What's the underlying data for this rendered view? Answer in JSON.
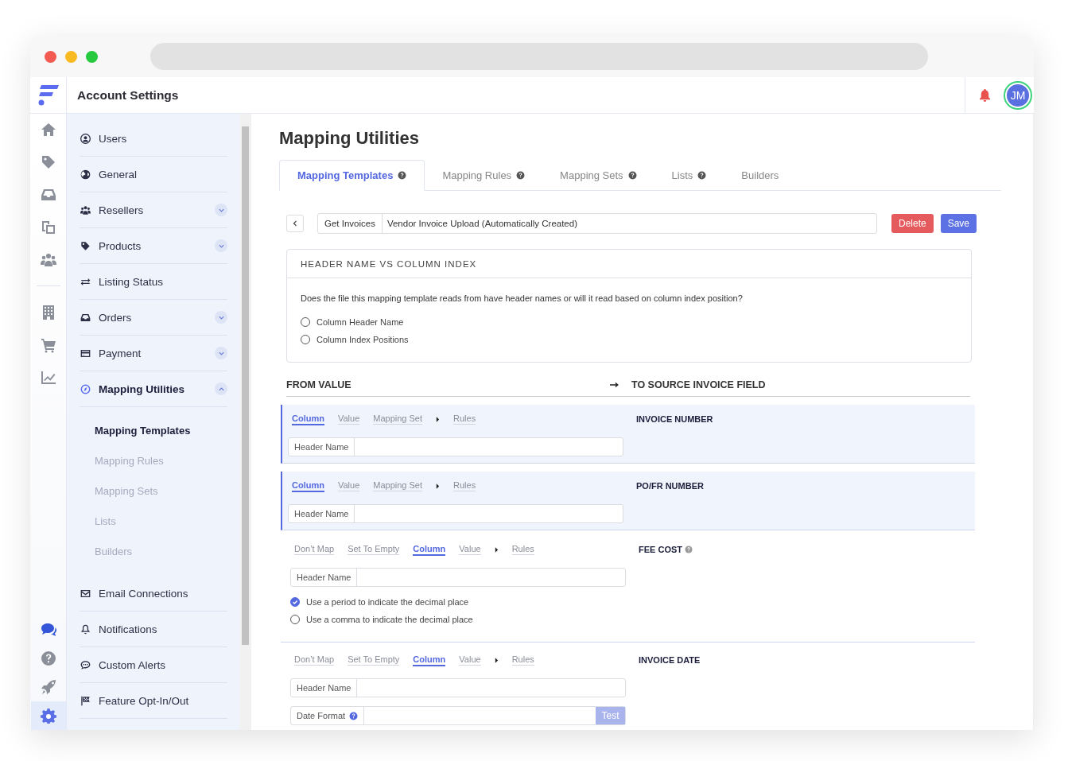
{
  "header": {
    "title": "Account Settings",
    "avatar": "JM"
  },
  "rail": {
    "groups": [
      [
        {
          "selected": false
        },
        {
          "selected": false
        },
        {
          "selected": false
        },
        {
          "selected": false
        },
        {
          "selected": false
        }
      ],
      [
        {
          "selected": false
        },
        {
          "selected": false
        },
        {
          "selected": false
        }
      ],
      [
        {
          "selected": false
        },
        {
          "selected": false
        },
        {
          "selected": false
        },
        {
          "selected": true
        }
      ]
    ]
  },
  "sidebar": {
    "items": [
      {
        "label": "Users",
        "selected": false
      },
      {
        "label": "General",
        "selected": false
      },
      {
        "label": "Resellers",
        "expanded": false,
        "selected": false
      },
      {
        "label": "Products",
        "expanded": false,
        "selected": false
      },
      {
        "label": "Listing Status",
        "selected": false
      },
      {
        "label": "Orders",
        "expanded": false,
        "selected": false
      },
      {
        "label": "Payment",
        "expanded": false,
        "selected": false
      },
      {
        "label": "Mapping Utilities",
        "expanded": true,
        "selected": true,
        "children": [
          {
            "label": "Mapping Templates",
            "selected": true
          },
          {
            "label": "Mapping Rules",
            "selected": false
          },
          {
            "label": "Mapping Sets",
            "selected": false
          },
          {
            "label": "Lists",
            "selected": false
          },
          {
            "label": "Builders",
            "selected": false
          }
        ]
      },
      {
        "label": "Email Connections",
        "selected": false
      },
      {
        "label": "Notifications",
        "selected": false
      },
      {
        "label": "Custom Alerts",
        "selected": false
      },
      {
        "label": "Feature Opt-In/Out",
        "selected": false
      }
    ]
  },
  "page": {
    "title": "Mapping Utilities",
    "tabs": [
      {
        "label": "Mapping Templates",
        "help": true,
        "selected": true
      },
      {
        "label": "Mapping Rules",
        "help": true,
        "selected": false
      },
      {
        "label": "Mapping Sets",
        "help": true,
        "selected": false
      },
      {
        "label": "Lists",
        "help": true,
        "selected": false
      },
      {
        "label": "Builders",
        "help": false,
        "selected": false
      }
    ],
    "template": {
      "type": "Get Invoices",
      "name": "Vendor Invoice Upload (Automatically Created)",
      "buttons": [
        {
          "label": "Delete",
          "kind": "danger"
        },
        {
          "label": "Save",
          "kind": "primary"
        }
      ]
    },
    "header_card": {
      "title": "HEADER NAME VS COLUMN INDEX",
      "question": "Does the file this mapping template reads from have header names or will it read based on column index position?",
      "options": [
        {
          "label": "Column Header Name",
          "checked": false
        },
        {
          "label": "Column Index Positions",
          "checked": false
        }
      ]
    },
    "mapping": {
      "from_heading": "FROM VALUE",
      "to_heading": "TO SOURCE INVOICE FIELD",
      "rows": [
        {
          "highlighted": true,
          "field": "INVOICE NUMBER",
          "help": false,
          "modes": [
            {
              "kind": "tab",
              "label": "Column",
              "selected": true
            },
            {
              "kind": "tab",
              "label": "Value",
              "selected": false
            },
            {
              "kind": "tab",
              "label": "Mapping Set",
              "selected": false
            },
            {
              "kind": "caret"
            },
            {
              "kind": "tab",
              "label": "Rules",
              "selected": false
            }
          ],
          "inputs": [
            {
              "label": "Header Name",
              "help": false
            }
          ]
        },
        {
          "highlighted": true,
          "field": "PO/FR NUMBER",
          "help": false,
          "modes": [
            {
              "kind": "tab",
              "label": "Column",
              "selected": true
            },
            {
              "kind": "tab",
              "label": "Value",
              "selected": false
            },
            {
              "kind": "tab",
              "label": "Mapping Set",
              "selected": false
            },
            {
              "kind": "caret"
            },
            {
              "kind": "tab",
              "label": "Rules",
              "selected": false
            }
          ],
          "inputs": [
            {
              "label": "Header Name",
              "help": false
            }
          ]
        },
        {
          "highlighted": false,
          "field": "FEE COST",
          "help": true,
          "modes": [
            {
              "kind": "tab",
              "label": "Don’t Map",
              "selected": false
            },
            {
              "kind": "tab",
              "label": "Set To Empty",
              "selected": false
            },
            {
              "kind": "tab",
              "label": "Column",
              "selected": true
            },
            {
              "kind": "tab",
              "label": "Value",
              "selected": false
            },
            {
              "kind": "caret"
            },
            {
              "kind": "tab",
              "label": "Rules",
              "selected": false
            }
          ],
          "inputs": [
            {
              "label": "Header Name",
              "help": false
            }
          ],
          "options": [
            {
              "label": "Use a period to indicate the decimal place",
              "checked": true
            },
            {
              "label": "Use a comma to indicate the decimal place",
              "checked": false
            }
          ]
        },
        {
          "highlighted": false,
          "field": "INVOICE DATE",
          "help": false,
          "modes": [
            {
              "kind": "tab",
              "label": "Don’t Map",
              "selected": false
            },
            {
              "kind": "tab",
              "label": "Set To Empty",
              "selected": false
            },
            {
              "kind": "tab",
              "label": "Column",
              "selected": true
            },
            {
              "kind": "tab",
              "label": "Value",
              "selected": false
            },
            {
              "kind": "caret"
            },
            {
              "kind": "tab",
              "label": "Rules",
              "selected": false
            }
          ],
          "inputs": [
            {
              "label": "Header Name",
              "help": false
            },
            {
              "label": "Date Format",
              "help": true,
              "action": "Test"
            }
          ]
        }
      ]
    }
  }
}
